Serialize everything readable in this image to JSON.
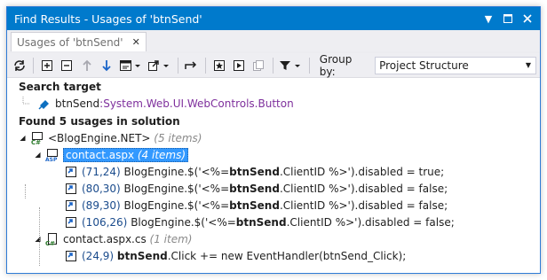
{
  "window": {
    "title": "Find Results - Usages of 'btnSend'"
  },
  "tab": {
    "label": "Usages of 'btnSend'"
  },
  "toolbar": {
    "group_by_label": "Group by:",
    "group_by_value": "Project Structure"
  },
  "search_target": {
    "heading": "Search target",
    "name": "btnSend",
    "type": ":System.Web.UI.WebControls.Button"
  },
  "results": {
    "heading": "Found 5 usages in solution",
    "project": {
      "name": "<BlogEngine.NET>",
      "count": "(5 items)"
    },
    "files": [
      {
        "name": "contact.aspx",
        "count": "(4 items)",
        "usages": [
          {
            "pos": "(71,24)",
            "pre": "BlogEngine.$('<%=",
            "match": "btnSend",
            "post": ".ClientID %>').disabled = true;"
          },
          {
            "pos": "(80,30)",
            "pre": "BlogEngine.$('<%=",
            "match": "btnSend",
            "post": ".ClientID %>').disabled = false;"
          },
          {
            "pos": "(89,30)",
            "pre": "BlogEngine.$('<%=",
            "match": "btnSend",
            "post": ".ClientID %>').disabled = false;"
          },
          {
            "pos": "(106,26)",
            "pre": "BlogEngine.$('<%=",
            "match": "btnSend",
            "post": ".ClientID %>').disabled = false;"
          }
        ]
      },
      {
        "name": "contact.aspx.cs",
        "count": "(1 item)",
        "usages": [
          {
            "pos": "(24,9)",
            "pre": "",
            "match": "btnSend",
            "post": ".Click += new EventHandler(btnSend_Click);"
          }
        ]
      }
    ]
  }
}
